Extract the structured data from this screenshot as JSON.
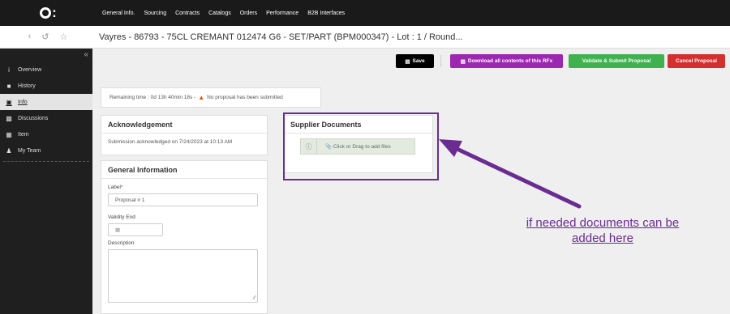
{
  "nav": {
    "logo": "O:",
    "items": [
      "General Info.",
      "Sourcing",
      "Contracts",
      "Catalogs",
      "Orders",
      "Performance",
      "B2B Interfaces"
    ]
  },
  "titlebar": {
    "title": "Vayres - 86793 - 75CL CREMANT 012474 G6 - SET/PART (BPM000347) - Lot : 1 / Round..."
  },
  "sidebar": {
    "items": [
      {
        "label": "Overview",
        "icon": "info-icon"
      },
      {
        "label": "History",
        "icon": "history-icon"
      },
      {
        "label": "Info",
        "icon": "info-doc-icon",
        "active": true
      },
      {
        "label": "Discussions",
        "icon": "discussions-icon"
      },
      {
        "label": "Item",
        "icon": "item-icon"
      },
      {
        "label": "My Team",
        "icon": "team-icon"
      }
    ]
  },
  "toolbar": {
    "save_label": "Save",
    "download_label": "Download all contents of this RFx",
    "validate_label": "Validate & Submit Proposal",
    "cancel_label": "Cancel Proposal",
    "colors": {
      "save": "#000000",
      "download": "#9c27b0",
      "validate": "#3fb14f",
      "cancel": "#d32f2f"
    }
  },
  "status": {
    "remaining": "Remaining time : 0d 13h 40min 18s -",
    "proposal": "No proposal has been submitted"
  },
  "acknowledgement": {
    "title": "Acknowledgement",
    "text": "Submission acknowledged on 7/24/2023 at 10:13 AM"
  },
  "general_info": {
    "title": "General Information",
    "label_label": "Label",
    "label_value": "Proposal # 1",
    "validity_label": "Validity End",
    "description_label": "Description"
  },
  "supplier_docs": {
    "title": "Supplier Documents",
    "dropzone_text": "Click or Drag to add files"
  },
  "annotation": {
    "line1": "if needed documents can be",
    "line2": "added here",
    "color": "#6a2c91"
  }
}
